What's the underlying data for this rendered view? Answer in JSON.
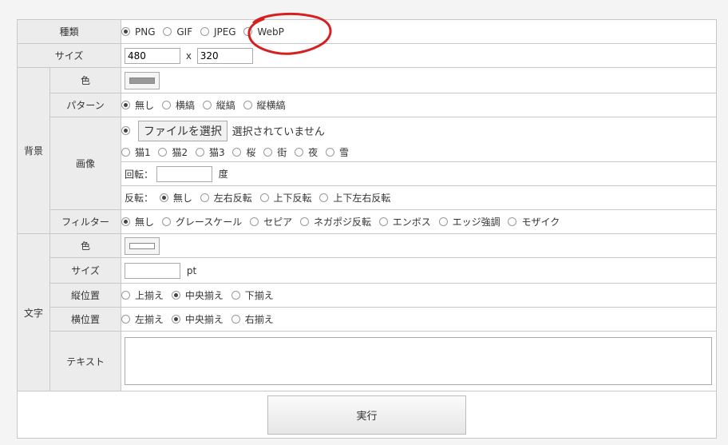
{
  "form": {
    "format": {
      "label": "種類",
      "options": [
        "PNG",
        "GIF",
        "JPEG",
        "WebP"
      ],
      "selected": "PNG"
    },
    "size": {
      "label": "サイズ",
      "width_value": "480",
      "separator": "x",
      "height_value": "320"
    },
    "background": {
      "group_label": "背景",
      "color_label": "色",
      "color_value": "#999999",
      "pattern": {
        "label": "パターン",
        "options": [
          "無し",
          "横縞",
          "縦縞",
          "縦横縞"
        ],
        "selected": "無し"
      },
      "image": {
        "label": "画像",
        "file_button": "ファイルを選択",
        "file_status": "選択されていません",
        "presets": [
          "猫1",
          "猫2",
          "猫3",
          "桜",
          "街",
          "夜",
          "雪"
        ],
        "rotation_label": "回転：",
        "rotation_value": "",
        "rotation_unit": "度",
        "flip_label": "反転：",
        "flip_options": [
          "無し",
          "左右反転",
          "上下反転",
          "上下左右反転"
        ],
        "flip_selected": "無し"
      },
      "filter": {
        "label": "フィルター",
        "options": [
          "無し",
          "グレースケール",
          "セピア",
          "ネガポジ反転",
          "エンボス",
          "エッジ強調",
          "モザイク"
        ],
        "selected": "無し"
      }
    },
    "text": {
      "group_label": "文字",
      "color_label": "色",
      "color_value": "#ffffff",
      "size_label": "サイズ",
      "size_value": "",
      "size_unit": "pt",
      "valign": {
        "label": "縦位置",
        "options": [
          "上揃え",
          "中央揃え",
          "下揃え"
        ],
        "selected": "中央揃え"
      },
      "halign": {
        "label": "横位置",
        "options": [
          "左揃え",
          "中央揃え",
          "右揃え"
        ],
        "selected": "中央揃え"
      },
      "content_label": "テキスト",
      "content_value": ""
    },
    "submit_label": "実行"
  },
  "annotation": {
    "color": "#d62020",
    "shape": "red hand-drawn circle around WebP option"
  }
}
